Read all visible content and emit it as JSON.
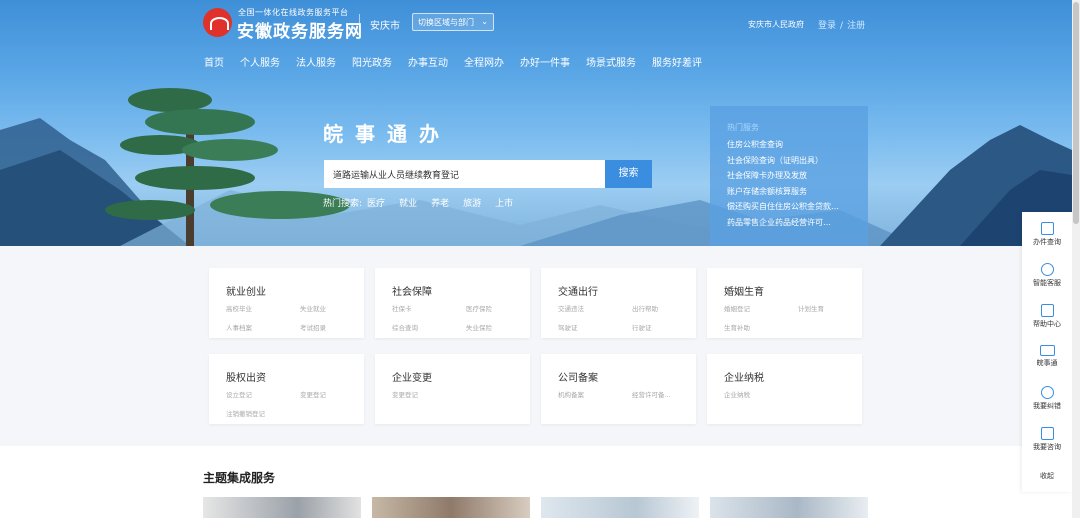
{
  "header": {
    "platform_subtitle": "全国一体化在线政务服务平台",
    "site_title": "安徽政务服务网",
    "city": "安庆市",
    "region_select": "切换区域与部门",
    "gov_link": "安庆市人民政府",
    "login": "登录",
    "separator": "/",
    "register": "注册"
  },
  "nav": [
    "首页",
    "个人服务",
    "法人服务",
    "阳光政务",
    "办事互动",
    "全程网办",
    "办好一件事",
    "场景式服务",
    "服务好差评"
  ],
  "hero": {
    "title": "皖事通办",
    "search_value": "道路运输从业人员继续教育登记",
    "search_button": "搜索",
    "hot_label": "热门搜索:",
    "hot_keywords": [
      "医疗",
      "就业",
      "养老",
      "旅游",
      "上市"
    ]
  },
  "hot_services": {
    "heading": "热门服务",
    "items": [
      "住房公积金查询",
      "社会保险查询（证明出具）",
      "社会保障卡办理及发放",
      "账户存储余额核算服务",
      "偿还购买自住住房公积金贷款…",
      "药品零售企业药品经营许可…"
    ]
  },
  "categories": [
    {
      "title": "就业创业",
      "items": [
        "高校毕业",
        "失业就业",
        "人事档案",
        "考试招录"
      ]
    },
    {
      "title": "社会保障",
      "items": [
        "社保卡",
        "医疗保险",
        "综合查询",
        "失业保险"
      ]
    },
    {
      "title": "交通出行",
      "items": [
        "交通违法",
        "出行帮助",
        "驾驶证",
        "行驶证"
      ]
    },
    {
      "title": "婚姻生育",
      "items": [
        "婚姻登记",
        "计划生育",
        "生育补助"
      ]
    },
    {
      "title": "股权出资",
      "items": [
        "设立登记",
        "变更登记",
        "注销撤销登记"
      ]
    },
    {
      "title": "企业变更",
      "items": [
        "变更登记"
      ]
    },
    {
      "title": "公司备案",
      "items": [
        "机构备案",
        "经营许可备..."
      ]
    },
    {
      "title": "企业纳税",
      "items": [
        "企业纳税"
      ]
    }
  ],
  "section": {
    "title": "主题集成服务"
  },
  "side_toolbar": [
    "办件查询",
    "智能客服",
    "帮助中心",
    "皖事通",
    "我要纠错",
    "我要咨询",
    "收起"
  ],
  "colors": {
    "primary": "#3b8de0",
    "logo_red": "#e0322b",
    "page_bg": "#f4f6f9"
  }
}
